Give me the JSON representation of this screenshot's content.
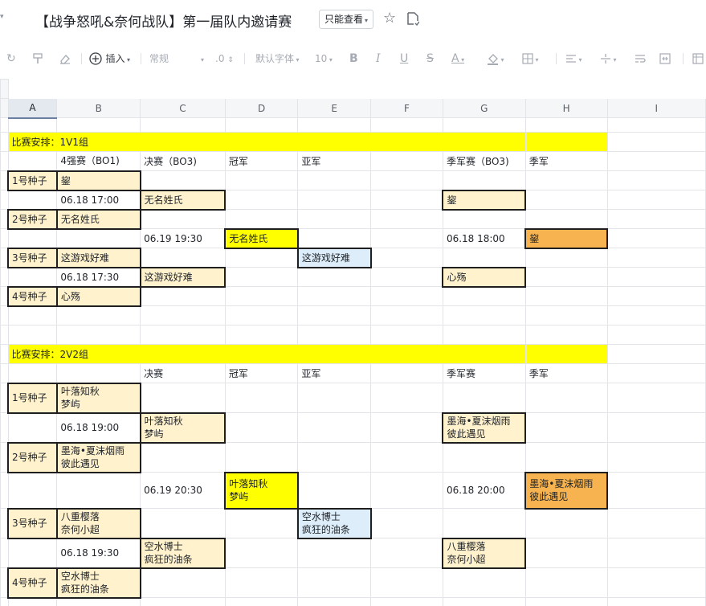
{
  "header": {
    "title": "【战争怒吼&奈何战队】第一届队内邀请赛",
    "mode_label": "只能查看"
  },
  "toolbar": {
    "insert_label": "插入",
    "format_label": "常规",
    "decimal_label": ".0",
    "font_label": "默认字体",
    "size_label": "10"
  },
  "columns": [
    "A",
    "B",
    "C",
    "D",
    "E",
    "F",
    "G",
    "H",
    "I"
  ],
  "sheet": {
    "s1": {
      "banner": "比赛安排：1V1组",
      "headers": {
        "b": "4强赛（BO1)",
        "c": "决赛（BO3)",
        "d": "冠军",
        "e": "亚军",
        "g": "季军赛（BO3)",
        "h": "季军"
      },
      "seed1": "1号种子",
      "seed2": "2号种子",
      "seed3": "3号种子",
      "seed4": "4号种子",
      "p1": "鋆",
      "p2": "无名姓氏",
      "p3": "这游戏好难",
      "p4": "心殇",
      "t1": "06.18 17:00",
      "t2": "06.18 17:30",
      "t_final": "06.19 19:30",
      "t_third": "06.18 18:00",
      "final1": "无名姓氏",
      "final2": "这游戏好难",
      "champion": "无名姓氏",
      "runnerup": "这游戏好难",
      "third1": "鋆",
      "third2": "心殇",
      "third_winner": "鋆"
    },
    "s2": {
      "banner": "比赛安排：2V2组",
      "headers": {
        "c": "决赛",
        "d": "冠军",
        "e": "亚军",
        "g": "季军赛",
        "h": "季军"
      },
      "seed1": "1号种子",
      "seed2": "2号种子",
      "seed3": "3号种子",
      "seed4": "4号种子",
      "team1_a": "叶落知秋",
      "team1_b": "梦屿",
      "team2_a": "墨海•夏沫烟雨",
      "team2_b": "彼此遇见",
      "team3_a": "八重樱落",
      "team3_b": "奈何小超",
      "team4_a": "空水博士",
      "team4_b": "疯狂的油条",
      "t1": "06.18 19:00",
      "t2": "06.18 19:30",
      "t_final": "06.19 20:30",
      "t_third": "06.18 20:00",
      "final1_a": "叶落知秋",
      "final1_b": "梦屿",
      "final2_a": "空水博士",
      "final2_b": "疯狂的油条",
      "champion_a": "叶落知秋",
      "champion_b": "梦屿",
      "runnerup_a": "空水博士",
      "runnerup_b": "疯狂的油条",
      "third1_a": "墨海•夏沫烟雨",
      "third1_b": "彼此遇见",
      "third2_a": "八重樱落",
      "third2_b": "奈何小超",
      "third_winner_a": "墨海•夏沫烟雨",
      "third_winner_b": "彼此遇见"
    }
  }
}
